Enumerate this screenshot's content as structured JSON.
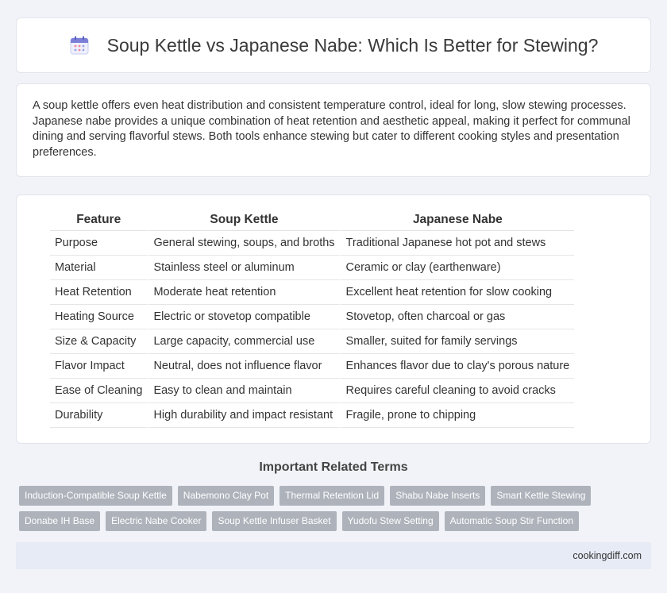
{
  "header": {
    "title": "Soup Kettle vs Japanese Nabe: Which Is Better for Stewing?",
    "icon": "calendar-icon"
  },
  "intro": {
    "text": "A soup kettle offers even heat distribution and consistent temperature control, ideal for long, slow stewing processes. Japanese nabe provides a unique combination of heat retention and aesthetic appeal, making it perfect for communal dining and serving flavorful stews. Both tools enhance stewing but cater to different cooking styles and presentation preferences."
  },
  "table": {
    "headers": [
      "Feature",
      "Soup Kettle",
      "Japanese Nabe"
    ],
    "rows": [
      [
        "Purpose",
        "General stewing, soups, and broths",
        "Traditional Japanese hot pot and stews"
      ],
      [
        "Material",
        "Stainless steel or aluminum",
        "Ceramic or clay (earthenware)"
      ],
      [
        "Heat Retention",
        "Moderate heat retention",
        "Excellent heat retention for slow cooking"
      ],
      [
        "Heating Source",
        "Electric or stovetop compatible",
        "Stovetop, often charcoal or gas"
      ],
      [
        "Size & Capacity",
        "Large capacity, commercial use",
        "Smaller, suited for family servings"
      ],
      [
        "Flavor Impact",
        "Neutral, does not influence flavor",
        "Enhances flavor due to clay's porous nature"
      ],
      [
        "Ease of Cleaning",
        "Easy to clean and maintain",
        "Requires careful cleaning to avoid cracks"
      ],
      [
        "Durability",
        "High durability and impact resistant",
        "Fragile, prone to chipping"
      ]
    ]
  },
  "related": {
    "title": "Important Related Terms",
    "tags_row1": [
      "Induction-Compatible Soup Kettle",
      "Nabemono Clay Pot",
      "Thermal Retention Lid",
      "Shabu Nabe Inserts",
      "Smart Kettle Stewing"
    ],
    "tags_row2": [
      "Donabe IH Base",
      "Electric Nabe Cooker",
      "Soup Kettle Infuser Basket",
      "Yudofu Stew Setting",
      "Automatic Soup Stir Function"
    ]
  },
  "footer": {
    "site": "cookingdiff.com"
  },
  "colors": {
    "background": "#f1f3f8",
    "tag": "#aeb3bb",
    "footer": "#e7ebf5"
  }
}
